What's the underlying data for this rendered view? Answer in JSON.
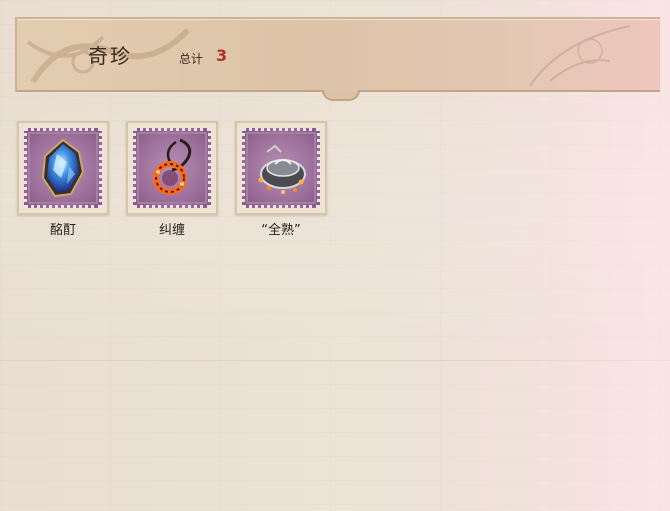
{
  "header": {
    "title": "奇珍",
    "total_label": "总计",
    "total_count": "3"
  },
  "items": [
    {
      "label": "酩酊",
      "icon": "blue-crystal-icon"
    },
    {
      "label": "纠缠",
      "icon": "ember-necklace-icon"
    },
    {
      "label": "“全熟”",
      "icon": "cooking-pot-icon"
    }
  ],
  "colors": {
    "header_bg": "#dcc3a6",
    "count_red": "#b03030",
    "stamp_purple": "#9a6c98"
  }
}
